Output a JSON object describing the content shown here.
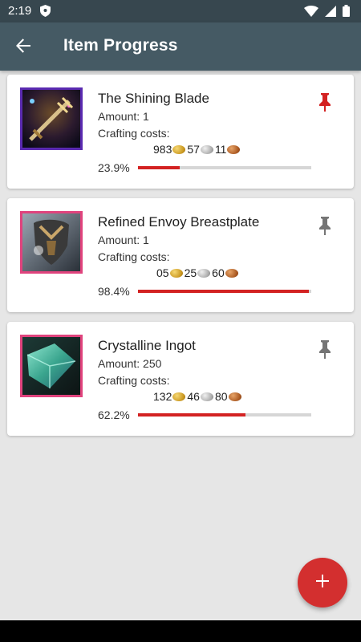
{
  "status_bar": {
    "time": "2:19"
  },
  "app_bar": {
    "title": "Item Progress"
  },
  "items": [
    {
      "name": "The Shining Blade",
      "amount": "Amount: 1",
      "costs_label": "Crafting costs:",
      "gold": "983",
      "silver": "57",
      "copper": "11",
      "percent_text": "23.9%",
      "progress": 0.239,
      "pinned": true,
      "frame_color": "#5a2ab0"
    },
    {
      "name": "Refined Envoy Breastplate",
      "amount": "Amount: 1",
      "costs_label": "Crafting costs:",
      "gold": "05",
      "silver": "25",
      "copper": "60",
      "percent_text": "98.4%",
      "progress": 0.984,
      "pinned": false,
      "frame_color": "#e0437d"
    },
    {
      "name": "Crystalline Ingot",
      "amount": "Amount: 250",
      "costs_label": "Crafting costs:",
      "gold": "132",
      "silver": "46",
      "copper": "80",
      "percent_text": "62.2%",
      "progress": 0.622,
      "pinned": false,
      "frame_color": "#e0437d"
    }
  ],
  "colors": {
    "app_bar": "#455a64",
    "status_bar": "#37474f",
    "accent": "#d32f2f",
    "pin_active": "#d32222",
    "pin_inactive": "#757575"
  },
  "icons": {
    "back": "arrow-back-icon",
    "pin": "pin-icon",
    "add": "add-icon",
    "gold_coin": "gold-coin-icon",
    "silver_coin": "silver-coin-icon",
    "copper_coin": "copper-coin-icon"
  }
}
